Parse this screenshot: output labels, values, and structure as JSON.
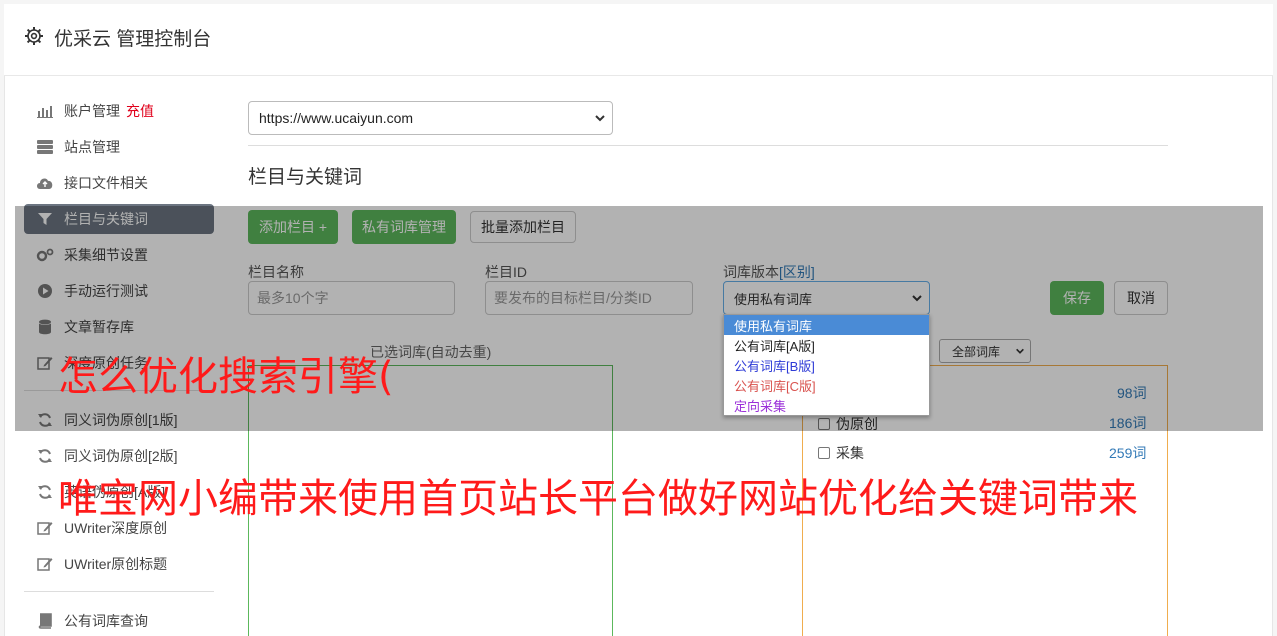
{
  "header": {
    "title": "优采云 管理控制台"
  },
  "sidebar": {
    "items": [
      {
        "label": "账户管理",
        "extra": "充值",
        "icon": "bar-chart-icon"
      },
      {
        "label": "站点管理",
        "icon": "server-icon"
      },
      {
        "label": "接口文件相关",
        "icon": "cloud-upload-icon"
      },
      {
        "label": "栏目与关键词",
        "icon": "filter-icon",
        "active": true
      },
      {
        "label": "采集细节设置",
        "icon": "cogs-icon"
      },
      {
        "label": "手动运行测试",
        "icon": "play-circle-icon"
      },
      {
        "label": "文章暂存库",
        "icon": "database-icon"
      },
      {
        "label": "深度原创任务",
        "icon": "edit-icon"
      },
      {
        "label": "同义词伪原创[1版]",
        "icon": "refresh-icon"
      },
      {
        "label": "同义词伪原创[2版]",
        "icon": "refresh-icon"
      },
      {
        "label": "英语伪原创[A版]",
        "icon": "refresh-icon"
      },
      {
        "label": "UWriter深度原创",
        "icon": "edit-icon"
      },
      {
        "label": "UWriter原创标题",
        "icon": "edit-icon"
      },
      {
        "label": "公有词库查询",
        "icon": "book-icon"
      }
    ]
  },
  "main": {
    "site_select": "https://www.ucaiyun.com",
    "section_title": "栏目与关键词",
    "buttons": {
      "add_column": "添加栏目 +",
      "private_lib": "私有词库管理",
      "batch_add": "批量添加栏目",
      "save": "保存",
      "cancel": "取消"
    },
    "form": {
      "name_label": "栏目名称",
      "name_placeholder": "最多10个字",
      "id_label": "栏目ID",
      "id_placeholder": "要发布的目标栏目/分类ID",
      "lib_label": "词库版本",
      "lib_label_link": "[区别]",
      "lib_value": "使用私有词库"
    },
    "lib_options": [
      "使用私有词库",
      "公有词库[A版]",
      "公有词库[B版]",
      "公有词库[C版]",
      "定向采集"
    ],
    "selected_label": "已选词库(自动去重)",
    "all_libs": "全部词库",
    "lib_rows": [
      {
        "label": "",
        "count": "98词"
      },
      {
        "label": "伪原创",
        "count": "186词"
      },
      {
        "label": "采集",
        "count": "259词"
      }
    ]
  },
  "watermark": {
    "line1": "怎么优化搜索引擎(",
    "line2": "唯宝网小编带来使用首页站长平台做好网站优化给关键词带来"
  },
  "colors": {
    "accent_green": "#5cb85c",
    "active_sidebar": "#6c7581",
    "watermark": "#ff1a1a",
    "charge": "#e0001b"
  }
}
